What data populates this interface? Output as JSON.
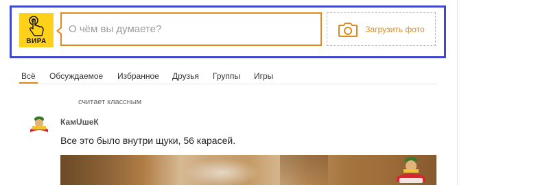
{
  "composer": {
    "avatar_label": "ВИРА",
    "placeholder": "О чём вы думаете?",
    "upload_label": "Загрузить фото"
  },
  "tabs": [
    {
      "label": "Всё",
      "active": true
    },
    {
      "label": "Обсуждаемое"
    },
    {
      "label": "Избранное"
    },
    {
      "label": "Друзья"
    },
    {
      "label": "Группы"
    },
    {
      "label": "Игры"
    }
  ],
  "feed": {
    "note": "считает классным",
    "post": {
      "author": "КамUшеК",
      "avatar_caption": "КамUшеК",
      "text": "Все это было внутри щуки, 56 карасей."
    }
  },
  "colors": {
    "accent": "#e08a1e",
    "highlight_border": "#3f48cc",
    "avatar_bg": "#ffd11a"
  }
}
